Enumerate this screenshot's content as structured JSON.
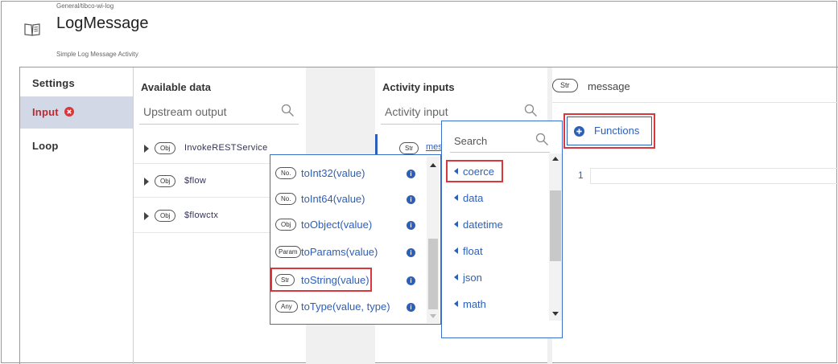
{
  "header": {
    "breadcrumb": "General/tibco-wi-log",
    "title": "LogMessage",
    "subtitle": "Simple Log Message Activity",
    "icon": "book-icon"
  },
  "nav": {
    "settings": "Settings",
    "input": "Input",
    "loop": "Loop",
    "error_color": "#d9373d"
  },
  "available": {
    "title": "Available data",
    "placeholder": "Upstream output",
    "items": [
      {
        "type": "Obj",
        "label": "InvokeRESTService"
      },
      {
        "type": "Obj",
        "label": "$flow"
      },
      {
        "type": "Obj",
        "label": "$flowctx"
      }
    ]
  },
  "activity": {
    "title": "Activity inputs",
    "placeholder": "Activity input",
    "item_type": "Str",
    "item_label": "mes"
  },
  "functions_list": {
    "items": [
      {
        "type": "No.",
        "label": "toInt32(value)"
      },
      {
        "type": "No.",
        "label": "toInt64(value)"
      },
      {
        "type": "Obj",
        "label": "toObject(value)"
      },
      {
        "type": "Param",
        "label": "toParams(value)"
      },
      {
        "type": "Str",
        "label": "toString(value)"
      },
      {
        "type": "Any",
        "label": "toType(value, type)"
      }
    ],
    "info_glyph": "i"
  },
  "categories": {
    "placeholder": "Search",
    "items": [
      "coerce",
      "data",
      "datetime",
      "float",
      "json",
      "math"
    ]
  },
  "editor": {
    "type": "Str",
    "field": "message",
    "functions_label": "Functions",
    "line_number": "1"
  },
  "colors": {
    "accent": "#2d5fb8",
    "highlight": "#d9373d",
    "nav_active": "#d3d8e6"
  }
}
